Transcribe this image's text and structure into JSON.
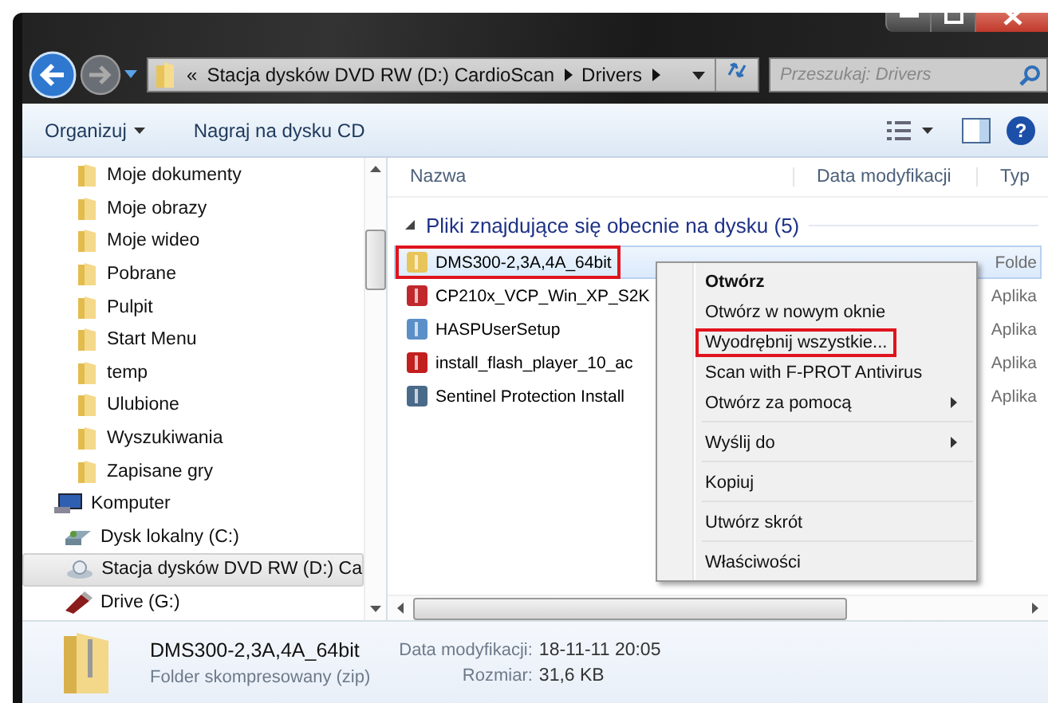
{
  "address_bar": {
    "segments": [
      "«",
      "Stacja dysków DVD RW (D:) CardioScan",
      "Drivers"
    ]
  },
  "search": {
    "placeholder": "Przeszukaj: Drivers"
  },
  "toolbar": {
    "buttons": [
      {
        "label": "Organizuj",
        "dropdown": true
      },
      {
        "label": "Nagraj na dysku CD",
        "dropdown": false
      }
    ],
    "help_label": "?"
  },
  "sidebar": {
    "items": [
      {
        "label": "Moje dokumenty",
        "selected": false
      },
      {
        "label": "Moje obrazy",
        "selected": false
      },
      {
        "label": "Moje wideo",
        "selected": false
      },
      {
        "label": "Pobrane",
        "selected": false
      },
      {
        "label": "Pulpit",
        "selected": false
      },
      {
        "label": "Start Menu",
        "selected": false
      },
      {
        "label": "temp",
        "selected": false
      },
      {
        "label": "Ulubione",
        "selected": false
      },
      {
        "label": "Wyszukiwania",
        "selected": false
      },
      {
        "label": "Zapisane gry",
        "selected": false
      },
      {
        "label": "Komputer",
        "selected": false,
        "children": [
          {
            "label": "Dysk lokalny (C:)",
            "selected": false
          },
          {
            "label": "Stacja dysków DVD RW (D:) Ca",
            "selected": true
          },
          {
            "label": "Drive (G:)",
            "selected": false
          }
        ]
      }
    ]
  },
  "file_list": {
    "columns": [
      "Nazwa",
      "Data modyfikacji",
      "Typ"
    ],
    "group": {
      "label": "Pliki znajdujące się obecnie na dysku (5)",
      "expanded": true
    },
    "rows": [
      {
        "name": "DMS300-2,3A,4A_64bit",
        "type": "Folde",
        "selected": true,
        "annotated": true
      },
      {
        "name": "CP210x_VCP_Win_XP_S2K",
        "type": "Aplika",
        "selected": false,
        "annotated": false
      },
      {
        "name": "HASPUserSetup",
        "type": "Aplika",
        "selected": false,
        "annotated": false
      },
      {
        "name": "install_flash_player_10_ac",
        "type": "Aplika",
        "selected": false,
        "annotated": false
      },
      {
        "name": "Sentinel Protection Install",
        "type": "Aplika",
        "selected": false,
        "annotated": false
      }
    ]
  },
  "context_menu": {
    "items": [
      {
        "kind": "item",
        "label": "Otwórz",
        "default": true,
        "submenu": false,
        "annotated": false
      },
      {
        "kind": "item",
        "label": "Otwórz w nowym oknie",
        "default": false,
        "submenu": false,
        "annotated": false
      },
      {
        "kind": "item",
        "label": "Wyodrębnij wszystkie...",
        "default": false,
        "submenu": false,
        "annotated": true
      },
      {
        "kind": "item",
        "label": "Scan with F-PROT Antivirus",
        "default": false,
        "submenu": false,
        "annotated": false
      },
      {
        "kind": "item",
        "label": "Otwórz za pomocą",
        "default": false,
        "submenu": true,
        "annotated": false
      },
      {
        "kind": "separator"
      },
      {
        "kind": "item",
        "label": "Wyślij do",
        "default": false,
        "submenu": true,
        "annotated": false
      },
      {
        "kind": "separator"
      },
      {
        "kind": "item",
        "label": "Kopiuj",
        "default": false,
        "submenu": false,
        "annotated": false
      },
      {
        "kind": "separator"
      },
      {
        "kind": "item",
        "label": "Utwórz skrót",
        "default": false,
        "submenu": false,
        "annotated": false
      },
      {
        "kind": "separator"
      },
      {
        "kind": "item",
        "label": "Właściwości",
        "default": false,
        "submenu": false,
        "annotated": false
      }
    ]
  },
  "details": {
    "name": "DMS300-2,3A,4A_64bit",
    "type": "Folder skompresowany (zip)",
    "fields": [
      {
        "label": "Data modyfikacji:",
        "value": "18-11-11 20:05"
      },
      {
        "label": "Rozmiar:",
        "value": "31,6 KB"
      }
    ]
  }
}
